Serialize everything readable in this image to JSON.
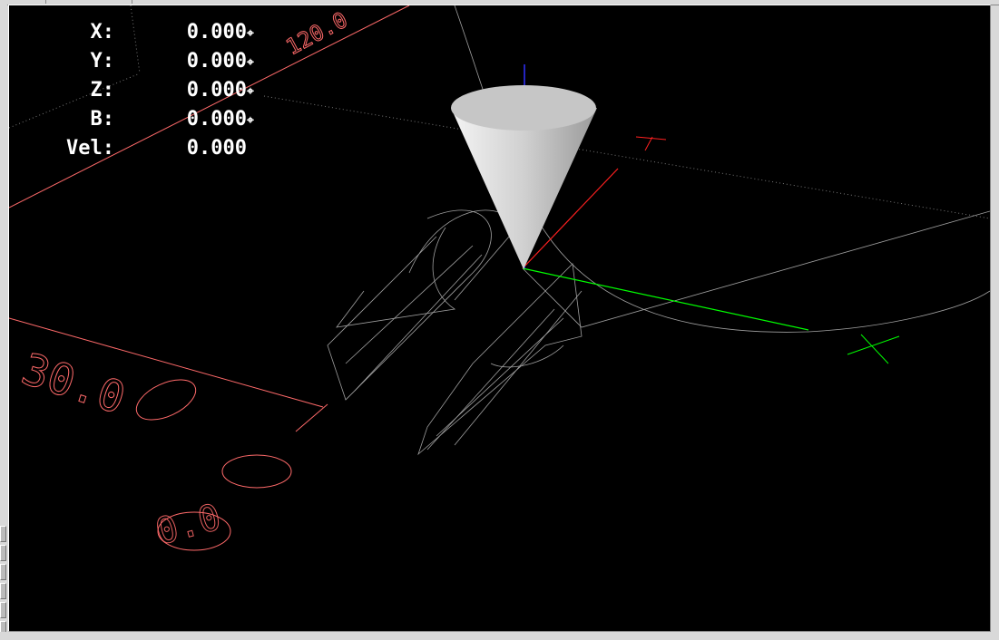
{
  "dro": [
    {
      "label": "X:",
      "value": "0.000",
      "homed": true
    },
    {
      "label": "Y:",
      "value": "0.000",
      "homed": true
    },
    {
      "label": "Z:",
      "value": "0.000",
      "homed": true
    },
    {
      "label": "B:",
      "value": "0.000",
      "homed": true
    },
    {
      "label": "Vel:",
      "value": "0.000",
      "homed": false
    }
  ],
  "extents_labels": {
    "x_extent": "120.0",
    "y_extent": "30.0",
    "origin": "0.0"
  },
  "colors": {
    "background": "#000000",
    "extents": "#ff6a6a",
    "x_axis": "#ff2020",
    "y_axis": "#00ff00",
    "z_axis": "#3030ff",
    "toolpath": "#cccccc",
    "tool": "#e0e0e0"
  },
  "icons": {
    "homed": "homed-crosshair-icon"
  }
}
